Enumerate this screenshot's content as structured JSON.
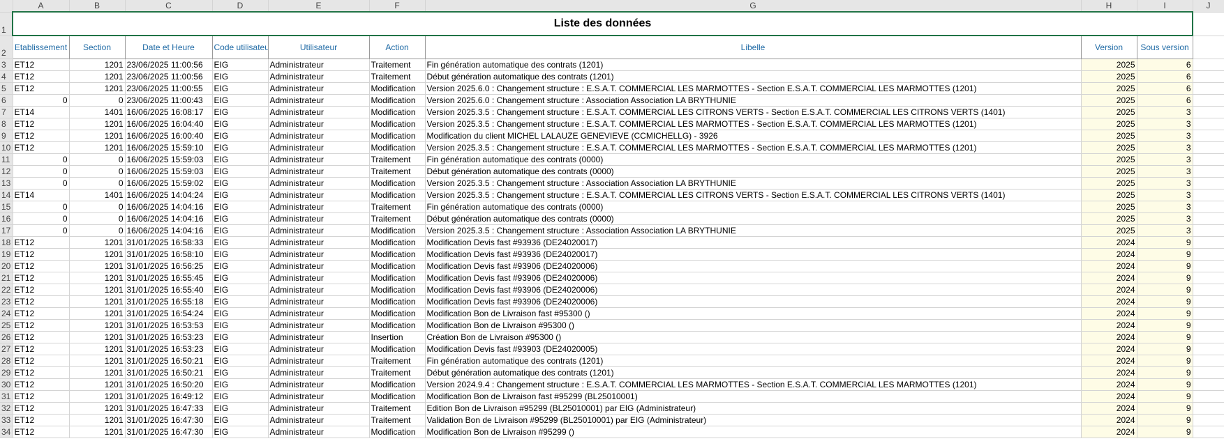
{
  "sheet": {
    "columns": [
      "",
      "A",
      "B",
      "C",
      "D",
      "E",
      "F",
      "G",
      "H",
      "I",
      "J"
    ],
    "title": "Liste des données",
    "title_row": "1",
    "header_row": "2",
    "headers": {
      "etablissement": "Etablissement",
      "section": "Section",
      "date": "Date et Heure",
      "code": "Code utilisateur",
      "utilisateur": "Utilisateur",
      "action": "Action",
      "libelle": "Libelle",
      "version": "Version",
      "sousversion": "Sous version"
    },
    "rows": [
      {
        "n": "3",
        "etab": "ET12",
        "section": "1201",
        "date": "23/06/2025 11:00:56",
        "code": "EIG",
        "user": "Administrateur",
        "action": "Traitement",
        "libelle": "Fin génération automatique des contrats  (1201)",
        "version": "2025",
        "sv": "6"
      },
      {
        "n": "4",
        "etab": "ET12",
        "section": "1201",
        "date": "23/06/2025 11:00:56",
        "code": "EIG",
        "user": "Administrateur",
        "action": "Traitement",
        "libelle": "Début génération automatique des contrats  (1201)",
        "version": "2025",
        "sv": "6"
      },
      {
        "n": "5",
        "etab": "ET12",
        "section": "1201",
        "date": "23/06/2025 11:00:55",
        "code": "EIG",
        "user": "Administrateur",
        "action": "Modification",
        "libelle": "Version 2025.6.0 : Changement structure : E.S.A.T. COMMERCIAL LES MARMOTTES - Section E.S.A.T. COMMERCIAL LES MARMOTTES (1201)",
        "version": "2025",
        "sv": "6"
      },
      {
        "n": "6",
        "etab": "0",
        "section": "0",
        "date": "23/06/2025 11:00:43",
        "code": "EIG",
        "user": "Administrateur",
        "action": "Modification",
        "libelle": "Version 2025.6.0 : Changement structure : Association Association LA BRYTHUNIE",
        "version": "2025",
        "sv": "6"
      },
      {
        "n": "7",
        "etab": "ET14",
        "section": "1401",
        "date": "16/06/2025 16:08:17",
        "code": "EIG",
        "user": "Administrateur",
        "action": "Modification",
        "libelle": "Version 2025.3.5 : Changement structure : E.S.A.T. COMMERCIAL LES CITRONS VERTS - Section E.S.A.T. COMMERCIAL LES CITRONS VERTS (1401)",
        "version": "2025",
        "sv": "3"
      },
      {
        "n": "8",
        "etab": "ET12",
        "section": "1201",
        "date": "16/06/2025 16:04:40",
        "code": "EIG",
        "user": "Administrateur",
        "action": "Modification",
        "libelle": "Version 2025.3.5 : Changement structure : E.S.A.T. COMMERCIAL LES MARMOTTES - Section E.S.A.T. COMMERCIAL LES MARMOTTES (1201)",
        "version": "2025",
        "sv": "3"
      },
      {
        "n": "9",
        "etab": "ET12",
        "section": "1201",
        "date": "16/06/2025 16:00:40",
        "code": "EIG",
        "user": "Administrateur",
        "action": "Modification",
        "libelle": "Modification du client MICHEL LALAUZE GENEVIEVE (CCMICHELLG) - 3926",
        "version": "2025",
        "sv": "3"
      },
      {
        "n": "10",
        "etab": "ET12",
        "section": "1201",
        "date": "16/06/2025 15:59:10",
        "code": "EIG",
        "user": "Administrateur",
        "action": "Modification",
        "libelle": "Version 2025.3.5 : Changement structure : E.S.A.T. COMMERCIAL LES MARMOTTES - Section E.S.A.T. COMMERCIAL LES MARMOTTES (1201)",
        "version": "2025",
        "sv": "3"
      },
      {
        "n": "11",
        "etab": "0",
        "section": "0",
        "date": "16/06/2025 15:59:03",
        "code": "EIG",
        "user": "Administrateur",
        "action": "Traitement",
        "libelle": "Fin génération automatique des contrats  (0000)",
        "version": "2025",
        "sv": "3"
      },
      {
        "n": "12",
        "etab": "0",
        "section": "0",
        "date": "16/06/2025 15:59:03",
        "code": "EIG",
        "user": "Administrateur",
        "action": "Traitement",
        "libelle": "Début génération automatique des contrats  (0000)",
        "version": "2025",
        "sv": "3"
      },
      {
        "n": "13",
        "etab": "0",
        "section": "0",
        "date": "16/06/2025 15:59:02",
        "code": "EIG",
        "user": "Administrateur",
        "action": "Modification",
        "libelle": "Version 2025.3.5 : Changement structure : Association Association LA BRYTHUNIE",
        "version": "2025",
        "sv": "3"
      },
      {
        "n": "14",
        "etab": "ET14",
        "section": "1401",
        "date": "16/06/2025 14:04:24",
        "code": "EIG",
        "user": "Administrateur",
        "action": "Modification",
        "libelle": "Version 2025.3.5 : Changement structure : E.S.A.T. COMMERCIAL LES CITRONS VERTS - Section E.S.A.T. COMMERCIAL LES CITRONS VERTS (1401)",
        "version": "2025",
        "sv": "3"
      },
      {
        "n": "15",
        "etab": "0",
        "section": "0",
        "date": "16/06/2025 14:04:16",
        "code": "EIG",
        "user": "Administrateur",
        "action": "Traitement",
        "libelle": "Fin génération automatique des contrats  (0000)",
        "version": "2025",
        "sv": "3"
      },
      {
        "n": "16",
        "etab": "0",
        "section": "0",
        "date": "16/06/2025 14:04:16",
        "code": "EIG",
        "user": "Administrateur",
        "action": "Traitement",
        "libelle": "Début génération automatique des contrats  (0000)",
        "version": "2025",
        "sv": "3"
      },
      {
        "n": "17",
        "etab": "0",
        "section": "0",
        "date": "16/06/2025 14:04:16",
        "code": "EIG",
        "user": "Administrateur",
        "action": "Modification",
        "libelle": "Version 2025.3.5 : Changement structure : Association Association LA BRYTHUNIE",
        "version": "2025",
        "sv": "3"
      },
      {
        "n": "18",
        "etab": "ET12",
        "section": "1201",
        "date": "31/01/2025 16:58:33",
        "code": "EIG",
        "user": "Administrateur",
        "action": "Modification",
        "libelle": "Modification Devis fast #93936 (DE24020017)",
        "version": "2024",
        "sv": "9"
      },
      {
        "n": "19",
        "etab": "ET12",
        "section": "1201",
        "date": "31/01/2025 16:58:10",
        "code": "EIG",
        "user": "Administrateur",
        "action": "Modification",
        "libelle": "Modification Devis fast #93936 (DE24020017)",
        "version": "2024",
        "sv": "9"
      },
      {
        "n": "20",
        "etab": "ET12",
        "section": "1201",
        "date": "31/01/2025 16:56:25",
        "code": "EIG",
        "user": "Administrateur",
        "action": "Modification",
        "libelle": "Modification Devis fast #93906 (DE24020006)",
        "version": "2024",
        "sv": "9"
      },
      {
        "n": "21",
        "etab": "ET12",
        "section": "1201",
        "date": "31/01/2025 16:55:45",
        "code": "EIG",
        "user": "Administrateur",
        "action": "Modification",
        "libelle": "Modification Devis fast #93906 (DE24020006)",
        "version": "2024",
        "sv": "9"
      },
      {
        "n": "22",
        "etab": "ET12",
        "section": "1201",
        "date": "31/01/2025 16:55:40",
        "code": "EIG",
        "user": "Administrateur",
        "action": "Modification",
        "libelle": "Modification Devis fast #93906 (DE24020006)",
        "version": "2024",
        "sv": "9"
      },
      {
        "n": "23",
        "etab": "ET12",
        "section": "1201",
        "date": "31/01/2025 16:55:18",
        "code": "EIG",
        "user": "Administrateur",
        "action": "Modification",
        "libelle": "Modification Devis fast #93906 (DE24020006)",
        "version": "2024",
        "sv": "9"
      },
      {
        "n": "24",
        "etab": "ET12",
        "section": "1201",
        "date": "31/01/2025 16:54:24",
        "code": "EIG",
        "user": "Administrateur",
        "action": "Modification",
        "libelle": "Modification Bon de Livraison fast #95300 ()",
        "version": "2024",
        "sv": "9"
      },
      {
        "n": "25",
        "etab": "ET12",
        "section": "1201",
        "date": "31/01/2025 16:53:53",
        "code": "EIG",
        "user": "Administrateur",
        "action": "Modification",
        "libelle": "Modification Bon de Livraison  #95300 ()",
        "version": "2024",
        "sv": "9"
      },
      {
        "n": "26",
        "etab": "ET12",
        "section": "1201",
        "date": "31/01/2025 16:53:23",
        "code": "EIG",
        "user": "Administrateur",
        "action": "Insertion",
        "libelle": "Création Bon de Livraison  #95300 ()",
        "version": "2024",
        "sv": "9"
      },
      {
        "n": "27",
        "etab": "ET12",
        "section": "1201",
        "date": "31/01/2025 16:53:23",
        "code": "EIG",
        "user": "Administrateur",
        "action": "Modification",
        "libelle": "Modification Devis fast #93903 (DE24020005)",
        "version": "2024",
        "sv": "9"
      },
      {
        "n": "28",
        "etab": "ET12",
        "section": "1201",
        "date": "31/01/2025 16:50:21",
        "code": "EIG",
        "user": "Administrateur",
        "action": "Traitement",
        "libelle": "Fin génération automatique des contrats  (1201)",
        "version": "2024",
        "sv": "9"
      },
      {
        "n": "29",
        "etab": "ET12",
        "section": "1201",
        "date": "31/01/2025 16:50:21",
        "code": "EIG",
        "user": "Administrateur",
        "action": "Traitement",
        "libelle": "Début génération automatique des contrats  (1201)",
        "version": "2024",
        "sv": "9"
      },
      {
        "n": "30",
        "etab": "ET12",
        "section": "1201",
        "date": "31/01/2025 16:50:20",
        "code": "EIG",
        "user": "Administrateur",
        "action": "Modification",
        "libelle": "Version 2024.9.4 : Changement structure : E.S.A.T. COMMERCIAL LES MARMOTTES - Section E.S.A.T. COMMERCIAL LES MARMOTTES (1201)",
        "version": "2024",
        "sv": "9"
      },
      {
        "n": "31",
        "etab": "ET12",
        "section": "1201",
        "date": "31/01/2025 16:49:12",
        "code": "EIG",
        "user": "Administrateur",
        "action": "Modification",
        "libelle": "Modification Bon de Livraison fast #95299 (BL25010001)",
        "version": "2024",
        "sv": "9"
      },
      {
        "n": "32",
        "etab": "ET12",
        "section": "1201",
        "date": "31/01/2025 16:47:33",
        "code": "EIG",
        "user": "Administrateur",
        "action": "Traitement",
        "libelle": "Edition Bon de Livraison  #95299 (BL25010001) par EIG (Administrateur)",
        "version": "2024",
        "sv": "9"
      },
      {
        "n": "33",
        "etab": "ET12",
        "section": "1201",
        "date": "31/01/2025 16:47:30",
        "code": "EIG",
        "user": "Administrateur",
        "action": "Traitement",
        "libelle": "Validation Bon de Livraison  #95299 (BL25010001) par EIG (Administrateur)",
        "version": "2024",
        "sv": "9"
      },
      {
        "n": "34",
        "etab": "ET12",
        "section": "1201",
        "date": "31/01/2025 16:47:30",
        "code": "EIG",
        "user": "Administrateur",
        "action": "Modification",
        "libelle": "Modification Bon de Livraison  #95299 ()",
        "version": "2024",
        "sv": "9"
      }
    ]
  }
}
